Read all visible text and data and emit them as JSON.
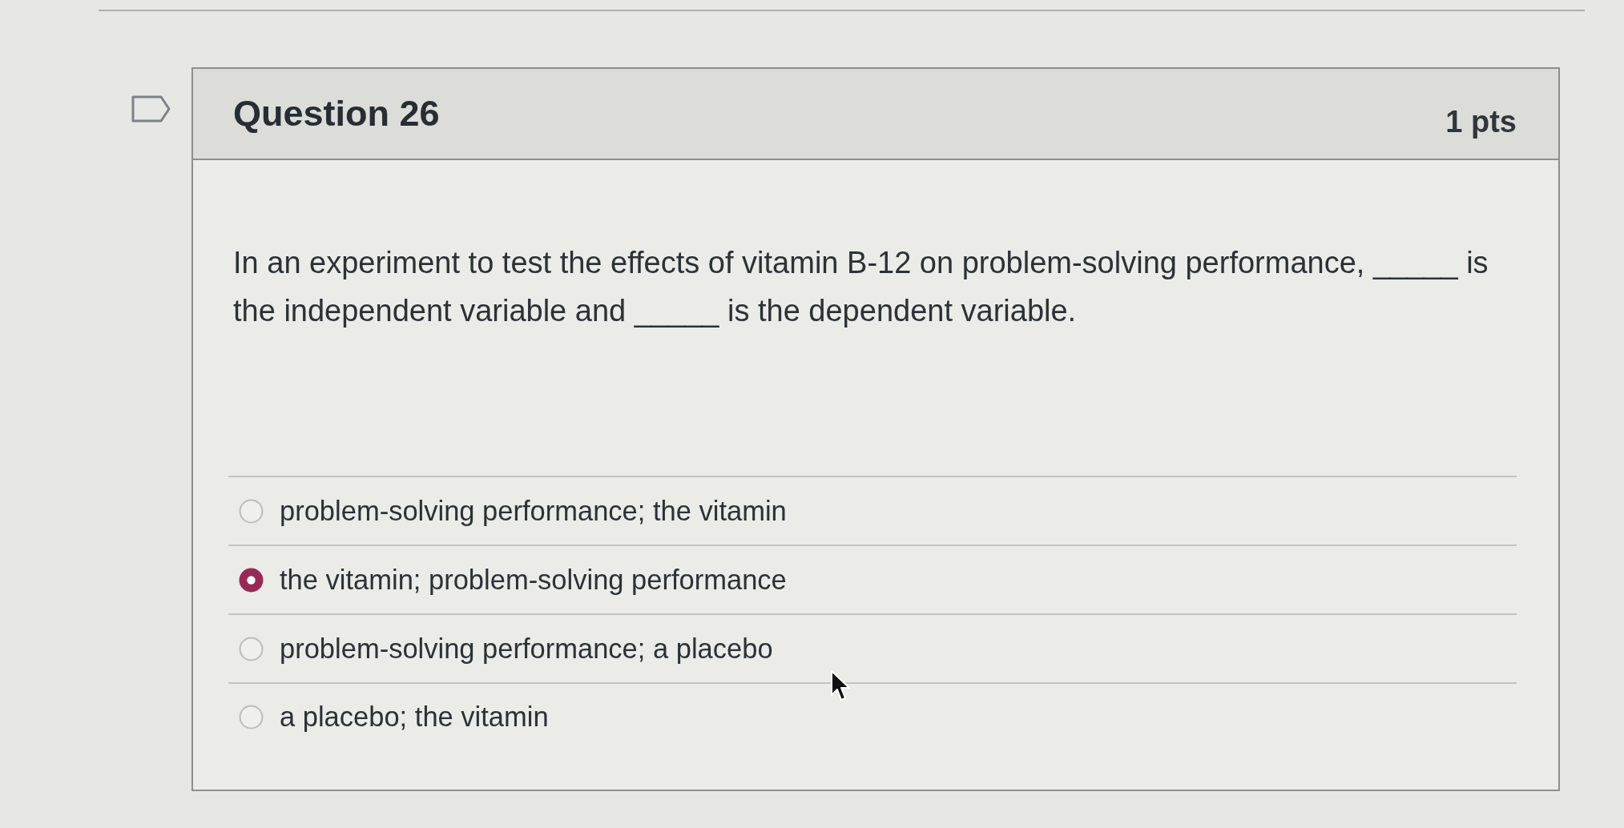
{
  "question": {
    "flagged": false,
    "title": "Question 26",
    "points": "1 pts",
    "prompt": "In an experiment to test the effects of vitamin B-12 on problem-solving performance, _____ is the independent variable and _____ is the dependent variable.",
    "answers": [
      {
        "label": "problem-solving performance; the vitamin",
        "selected": false
      },
      {
        "label": "the vitamin; problem-solving performance",
        "selected": true
      },
      {
        "label": "problem-solving performance; a placebo",
        "selected": false
      },
      {
        "label": "a placebo; the vitamin",
        "selected": false
      }
    ]
  }
}
